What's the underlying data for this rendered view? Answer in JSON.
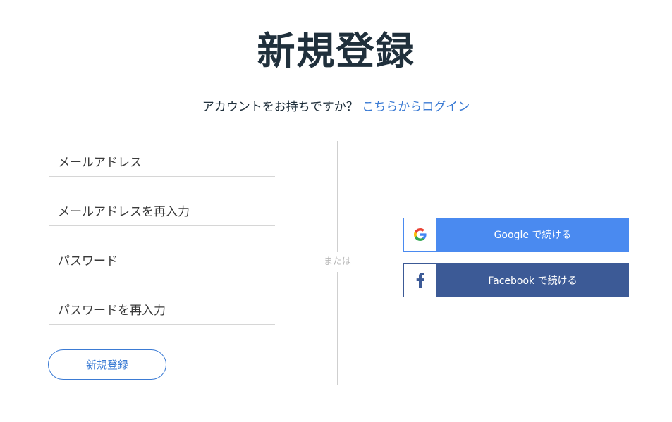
{
  "page": {
    "title": "新規登録"
  },
  "login_prompt": {
    "text": "アカウントをお持ちですか？",
    "link_label": "こちらからログイン"
  },
  "form": {
    "email_placeholder": "メールアドレス",
    "email_confirm_placeholder": "メールアドレスを再入力",
    "password_placeholder": "パスワード",
    "password_confirm_placeholder": "パスワードを再入力",
    "submit_label": "新規登録"
  },
  "divider": {
    "label": "または"
  },
  "social": {
    "google": {
      "label": "Google で続ける",
      "icon": "google-icon",
      "color": "#4a8af0"
    },
    "facebook": {
      "label": "Facebook で続ける",
      "icon": "facebook-icon",
      "color": "#3c5a96"
    }
  },
  "colors": {
    "accent": "#3b7bd4",
    "title": "#20303c"
  }
}
